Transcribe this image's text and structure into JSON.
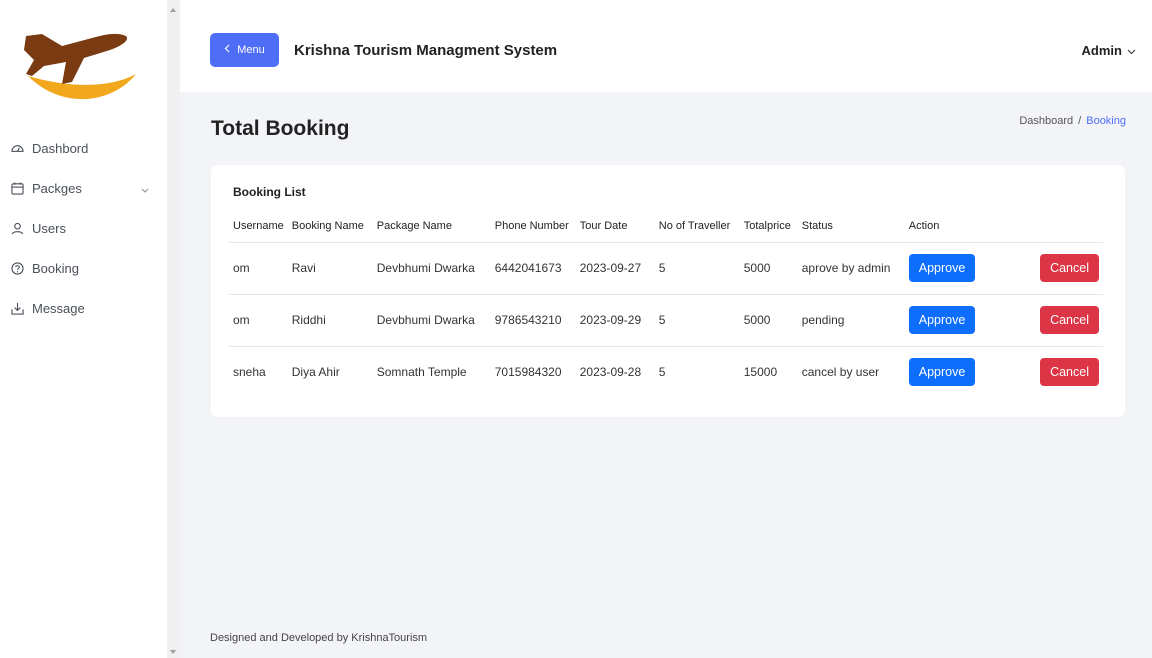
{
  "sidebar": {
    "items": [
      {
        "label": "Dashbord",
        "icon": "dashboard-icon"
      },
      {
        "label": "Packges",
        "icon": "calendar-icon"
      },
      {
        "label": "Users",
        "icon": "user-icon"
      },
      {
        "label": "Booking",
        "icon": "help-circle-icon"
      },
      {
        "label": "Message",
        "icon": "download-icon"
      }
    ]
  },
  "header": {
    "menu_label": "Menu",
    "title": "Krishna Tourism Managment System",
    "user_label": "Admin"
  },
  "page": {
    "title": "Total Booking",
    "breadcrumb": [
      "Dashboard",
      "Booking"
    ]
  },
  "card": {
    "title": "Booking List",
    "columns": [
      "Username",
      "Booking Name",
      "Package Name",
      "Phone Number",
      "Tour Date",
      "No of Traveller",
      "Totalprice",
      "Status",
      "Action"
    ],
    "rows": [
      {
        "username": "om",
        "booking_name": "Ravi",
        "package": "Devbhumi Dwarka",
        "phone": "6442041673",
        "date": "2023-09-27",
        "travellers": "5",
        "price": "5000",
        "status": "aprove by admin",
        "approve": "Approve",
        "cancel": "Cancel"
      },
      {
        "username": "om",
        "booking_name": "Riddhi",
        "package": "Devbhumi Dwarka",
        "phone": "9786543210",
        "date": "2023-09-29",
        "travellers": "5",
        "price": "5000",
        "status": "pending",
        "approve": "Approve",
        "cancel": "Cancel"
      },
      {
        "username": "sneha",
        "booking_name": "Diya Ahir",
        "package": "Somnath Temple",
        "phone": "7015984320",
        "date": "2023-09-28",
        "travellers": "5",
        "price": "15000",
        "status": "cancel by user",
        "approve": "Approve",
        "cancel": "Cancel"
      }
    ]
  },
  "footer": {
    "text": "Designed and Developed by KrishnaTourism"
  },
  "colors": {
    "primary": "#4f6ef7",
    "approve": "#0d6efd",
    "cancel": "#dc3545",
    "logo_plane": "#7a3a12",
    "logo_swoosh": "#f2a81d"
  }
}
